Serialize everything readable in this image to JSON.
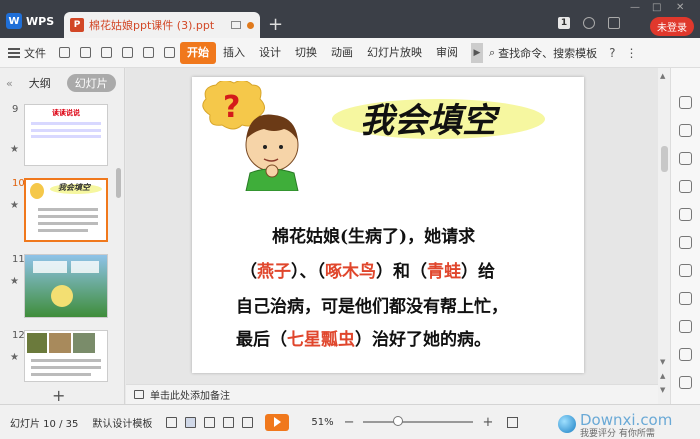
{
  "titlebar": {
    "app_name": "WPS",
    "doc_tab_title": "棉花姑娘ppt课件 (3).ppt",
    "page_badge": "1",
    "login_label": "未登录"
  },
  "ribbon": {
    "file_label": "文件",
    "tabs": [
      "开始",
      "插入",
      "设计",
      "切换",
      "动画",
      "幻灯片放映",
      "审阅"
    ],
    "active_tab": "开始",
    "search_label": "查找命令、搜索模板",
    "help": "?",
    "more": "⋮"
  },
  "left_panel": {
    "tabs": [
      "大纲",
      "幻灯片"
    ],
    "active_tab": "幻灯片",
    "slides": [
      {
        "num": "9",
        "title": "读读说说"
      },
      {
        "num": "10",
        "title": "我会填空",
        "selected": true
      },
      {
        "num": "11",
        "title": ""
      },
      {
        "num": "12",
        "title": ""
      }
    ],
    "add_slide": "+"
  },
  "slide": {
    "title": "我会填空",
    "lines": [
      {
        "parts": [
          {
            "t": "棉花姑娘(",
            "ans": false
          },
          {
            "t": "生病了",
            "ans": false
          },
          {
            "t": ")，她请求",
            "ans": false
          }
        ]
      },
      {
        "parts": [
          {
            "t": "（",
            "ans": false
          },
          {
            "t": "燕子",
            "ans": true
          },
          {
            "t": "）、（",
            "ans": false
          },
          {
            "t": "啄木鸟",
            "ans": true
          },
          {
            "t": "）和（",
            "ans": false
          },
          {
            "t": "青蛙",
            "ans": true
          },
          {
            "t": "）给",
            "ans": false
          }
        ]
      },
      {
        "parts": [
          {
            "t": "自己治病，可是他们都没有帮上忙，",
            "ans": false
          }
        ]
      },
      {
        "parts": [
          {
            "t": "最后（",
            "ans": false
          },
          {
            "t": "七星瓢虫",
            "ans": true
          },
          {
            "t": "）治好了她的病。",
            "ans": false
          }
        ]
      }
    ],
    "accent_color": "#e0462c"
  },
  "notes": {
    "placeholder": "单击此处添加备注"
  },
  "statusbar": {
    "slide_info": "幻灯片 10 / 35",
    "template": "默认设计模板",
    "zoom": "51%",
    "zoom_minus": "−",
    "zoom_plus": "+"
  },
  "watermark": {
    "text": "Downxi.com",
    "subtext": "我要评分 有你所需"
  }
}
